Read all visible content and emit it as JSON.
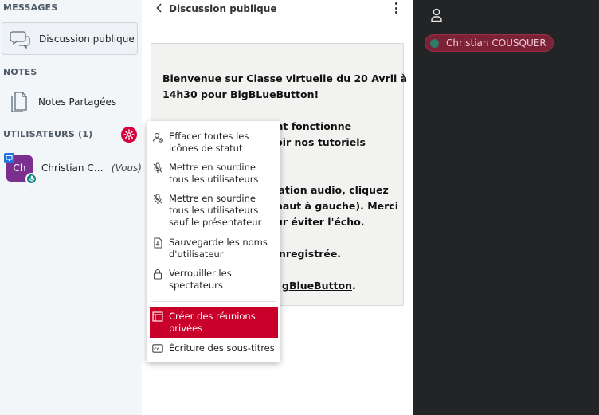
{
  "sidebar": {
    "messages_title": "MESSAGES",
    "public_chat_label": "Discussion publique",
    "notes_title": "NOTES",
    "shared_notes_label": "Notes Partagées",
    "users_title": "UTILISATEURS (1)",
    "users": [
      {
        "initials": "Ch",
        "name": "Christian COUSQUER",
        "you_label": "(Vous)",
        "avatar_color": "#7b2f8e"
      }
    ]
  },
  "chat": {
    "title": "Discussion publique",
    "welcome_lines": [
      "Bienvenue sur Classe virtuelle du 20 Avril à",
      "14h30 pour BigBLueButton!",
      "ent fonctionne",
      "voir nos ",
      "tutoriels",
      "cation audio, cliquez",
      "haut à gauche). Merci",
      "ur éviter l'écho.",
      "nregistrée.",
      "gBlueButton",
      "."
    ]
  },
  "menu": {
    "items": [
      {
        "label": "Effacer toutes les icônes de statut",
        "icon": "clear-status-icon"
      },
      {
        "label": "Mettre en sourdine tous les utilisateurs",
        "icon": "mute-icon"
      },
      {
        "label": "Mettre en sourdine tous les utilisateurs sauf le présentateur",
        "icon": "mute-icon"
      },
      {
        "label": "Sauvegarde les noms d'utilisateur",
        "icon": "download-icon"
      },
      {
        "label": "Verrouiller les spectateurs",
        "icon": "lock-icon"
      },
      {
        "label": "Créer des réunions privées",
        "icon": "rooms-icon"
      },
      {
        "label": "Écriture des sous-titres",
        "icon": "closed-caption-icon"
      }
    ]
  },
  "presentation": {
    "talker_name": "Christian COUSQUER"
  },
  "colors": {
    "accent": "#d6003b",
    "highlight": "#c8002a",
    "avatar": "#7b2f8e",
    "dark_bg": "#222426"
  }
}
